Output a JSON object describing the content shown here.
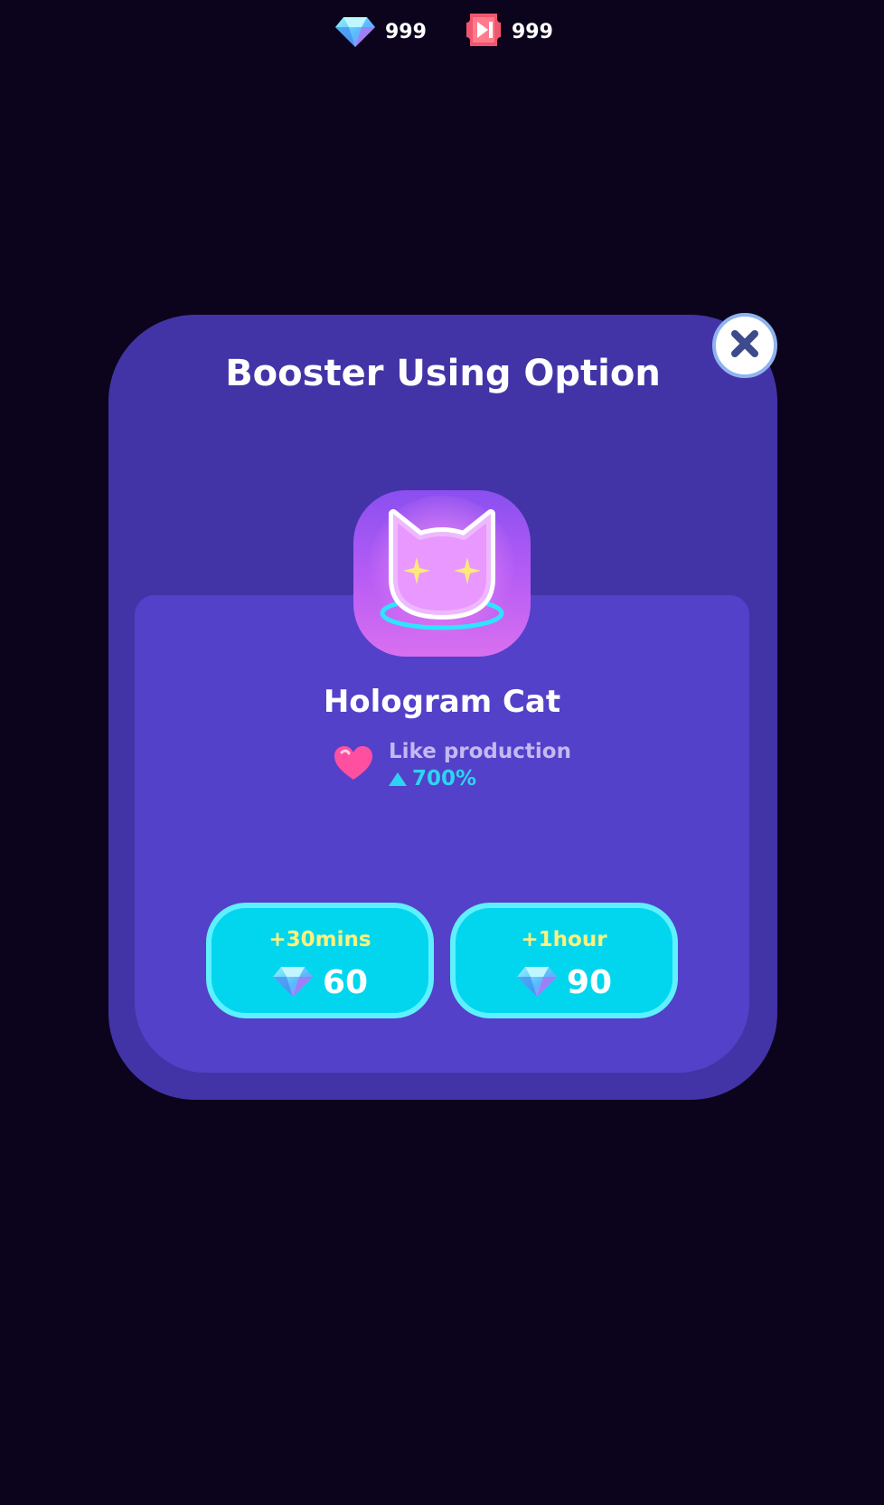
{
  "topbar": {
    "gems": "999",
    "tickets": "999",
    "gem_icon": "gem-icon",
    "ticket_icon": "skip-ticket-icon"
  },
  "dialog": {
    "title": "Booster Using Option",
    "close_icon": "close-icon",
    "booster": {
      "name": "Hologram Cat",
      "icon": "hologram-cat-icon",
      "effect_label": "Like production",
      "effect_value": "700%",
      "effect_icon": "heart-icon"
    },
    "options": [
      {
        "duration": "+30mins",
        "cost": "60"
      },
      {
        "duration": "+1hour",
        "cost": "90"
      }
    ]
  },
  "colors": {
    "background": "#0c041c",
    "dialog": "#4234a6",
    "panel": "#5341c9",
    "button": "#02d6ee",
    "button_border": "#5ff0ff",
    "duration_text": "#fff27a",
    "effect_value": "#2fd3f2"
  }
}
